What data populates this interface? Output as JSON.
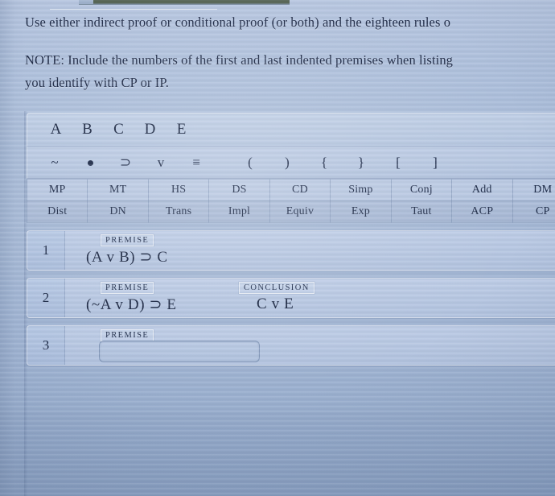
{
  "instructions": {
    "line1": "Use either indirect proof or conditional proof (or both) and the eighteen rules o",
    "note_line1": "NOTE: Include the numbers of the first and last indented premises when listing",
    "note_line2": "you identify with CP or IP."
  },
  "letters": [
    {
      "label": "A",
      "name": "letter-a"
    },
    {
      "label": "B",
      "name": "letter-b"
    },
    {
      "label": "C",
      "name": "letter-c"
    },
    {
      "label": "D",
      "name": "letter-d"
    },
    {
      "label": "E",
      "name": "letter-e"
    }
  ],
  "symbols": [
    {
      "label": "~",
      "name": "tilde-negation"
    },
    {
      "label": "•",
      "name": "dot-conjunction"
    },
    {
      "label": "⊃",
      "name": "horseshoe-implication"
    },
    {
      "label": "v",
      "name": "wedge-disjunction"
    },
    {
      "label": "≡",
      "name": "triple-bar-equivalence"
    },
    {
      "label": "(",
      "name": "left-paren"
    },
    {
      "label": ")",
      "name": "right-paren"
    },
    {
      "label": "{",
      "name": "left-brace"
    },
    {
      "label": "}",
      "name": "right-brace"
    },
    {
      "label": "[",
      "name": "left-bracket"
    },
    {
      "label": "]",
      "name": "right-bracket"
    }
  ],
  "rules": {
    "row1": [
      "MP",
      "MT",
      "HS",
      "DS",
      "CD",
      "Simp",
      "Conj",
      "Add",
      "DM"
    ],
    "row2": [
      "Dist",
      "DN",
      "Trans",
      "Impl",
      "Equiv",
      "Exp",
      "Taut",
      "ACP",
      "CP"
    ]
  },
  "proof_rows": [
    {
      "number": "1",
      "premise_tag": "PREMISE",
      "premise_formula": "(A v B) ⊃ C",
      "conclusion_tag": "",
      "conclusion_formula": "",
      "has_input": false,
      "input_value": "",
      "input_placeholder": ""
    },
    {
      "number": "2",
      "premise_tag": "PREMISE",
      "premise_formula": "(~A v D) ⊃ E",
      "conclusion_tag": "CONCLUSION",
      "conclusion_formula": "C v E",
      "has_input": false,
      "input_value": "",
      "input_placeholder": ""
    },
    {
      "number": "3",
      "premise_tag": "PREMISE",
      "premise_formula": "",
      "conclusion_tag": "",
      "conclusion_formula": "",
      "has_input": true,
      "input_value": "",
      "input_placeholder": ""
    }
  ],
  "colors": {
    "background": "#a9bcdb",
    "panel": "#bccbe4",
    "text": "#1b2845",
    "border": "#8094b6"
  }
}
